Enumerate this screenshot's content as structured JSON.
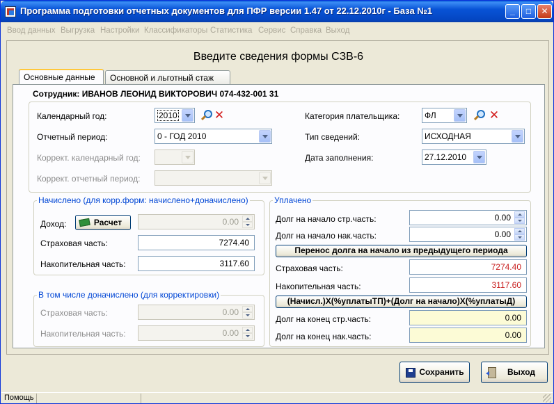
{
  "window": {
    "title": "Программа подготовки отчетных документов для ПФР версии 1.47 от 22.12.2010г - База №1",
    "controls": [
      "_",
      "□",
      "✕"
    ]
  },
  "menu": [
    "Ввод данных",
    "Выгрузка",
    "Настройки",
    "Классификаторы",
    "Статистика",
    "Сервис",
    "Справка",
    "Выход"
  ],
  "form": {
    "title": "Введите сведения формы СЗВ-6",
    "tabs": [
      "Основные данные",
      "Основной и льготный стаж"
    ],
    "employee": "Сотрудник: ИВАНОВ ЛЕОНИД ВИКТОРОВИЧ 074-432-001 31"
  },
  "fields": {
    "year_label": "Календарный год:",
    "year_value": "2010",
    "period_label": "Отчетный период:",
    "period_value": "0 - ГОД 2010",
    "corr_year_label": "Коррект. календарный год:",
    "corr_year_value": "",
    "corr_period_label": "Коррект. отчетный период:",
    "corr_period_value": "",
    "payer_cat_label": "Категория плательщика:",
    "payer_cat_value": "ФЛ",
    "info_type_label": "Тип сведений:",
    "info_type_value": "ИСХОДНАЯ",
    "fill_date_label": "Дата заполнения:",
    "fill_date_value": "27.12.2010"
  },
  "accrued": {
    "legend": "Начислено (для корр.форм: начислено+доначислено)",
    "income_label": "Доход:",
    "calc_button": "Расчет",
    "income_value": "0.00",
    "insurance_label": "Страховая часть:",
    "insurance_value": "7274.40",
    "funded_label": "Накопительная часть:",
    "funded_value": "3117.60"
  },
  "additional": {
    "legend": "В том числе доначислено (для корректировки)",
    "insurance_label": "Страховая часть:",
    "insurance_value": "0.00",
    "funded_label": "Накопительная часть:",
    "funded_value": "0.00"
  },
  "paid": {
    "legend": "Уплачено",
    "debt_start_ins_label": "Долг на начало стр.часть:",
    "debt_start_ins_value": "0.00",
    "debt_start_fund_label": "Долг на начало нак.часть:",
    "debt_start_fund_value": "0.00",
    "transfer_button": "Перенос долга на начало из предыдущего периода",
    "insurance_label": "Страховая часть:",
    "insurance_value": "7274.40",
    "funded_label": "Накопительная часть:",
    "funded_value": "3117.60",
    "formula_button": "(Начисл.)Х(%уплатыТП)+(Долг на начало)Х(%уплатыД)",
    "debt_end_ins_label": "Долг на конец стр.часть:",
    "debt_end_ins_value": "0.00",
    "debt_end_fund_label": "Долг на конец нак.часть:",
    "debt_end_fund_value": "0.00"
  },
  "buttons": {
    "save": "Сохранить",
    "exit": "Выход"
  },
  "status": {
    "help": "Помощь"
  }
}
